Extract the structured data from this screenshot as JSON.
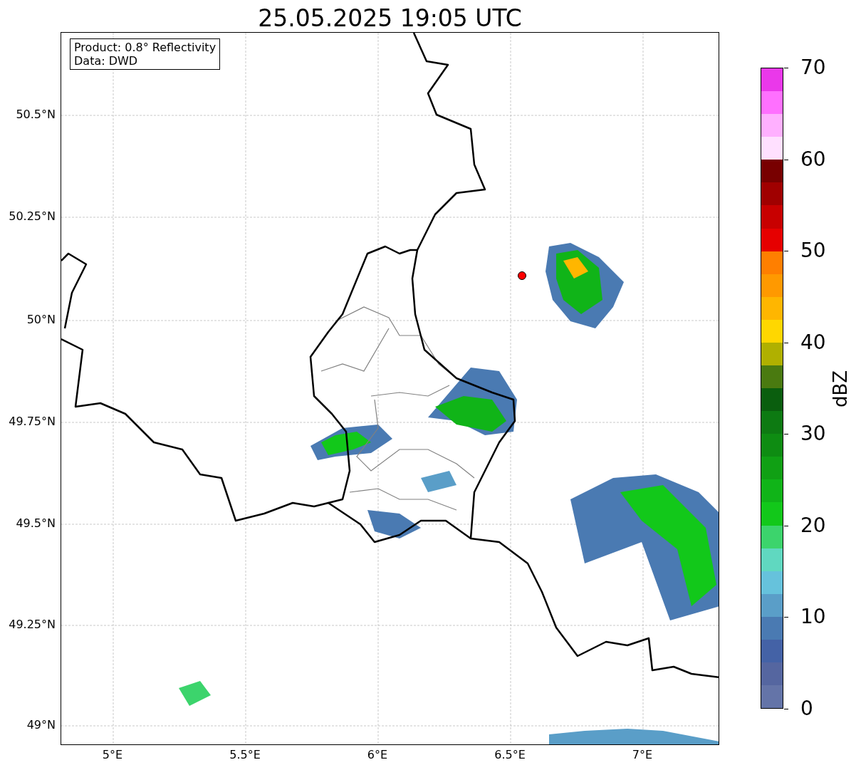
{
  "title": "25.05.2025 19:05 UTC",
  "info_box": [
    "Product: 0.8° Reflectivity",
    "Data: DWD"
  ],
  "lat_ticks": [
    "50.5°N",
    "50.25°N",
    "50°N",
    "49.75°N",
    "49.5°N",
    "49.25°N",
    "49°N"
  ],
  "lon_ticks": [
    "5°E",
    "5.5°E",
    "6°E",
    "6.5°E",
    "7°E"
  ],
  "colorbar": {
    "label": "dBZ",
    "ticks": [
      "70",
      "60",
      "50",
      "40",
      "30",
      "20",
      "10",
      "0"
    ],
    "segments": [
      {
        "color": "#ea38ea"
      },
      {
        "color": "#ff70ff"
      },
      {
        "color": "#ffb0ff"
      },
      {
        "color": "#ffe0ff"
      },
      {
        "color": "#780000"
      },
      {
        "color": "#a00000"
      },
      {
        "color": "#c80000"
      },
      {
        "color": "#e60000"
      },
      {
        "color": "#ff7f00"
      },
      {
        "color": "#ff9900"
      },
      {
        "color": "#ffb600"
      },
      {
        "color": "#ffd700"
      },
      {
        "color": "#b0b000"
      },
      {
        "color": "#4a7a10"
      },
      {
        "color": "#0a5e0e"
      },
      {
        "color": "#0d7a12"
      },
      {
        "color": "#0e8c12"
      },
      {
        "color": "#10a014"
      },
      {
        "color": "#10b418"
      },
      {
        "color": "#12c81a"
      },
      {
        "color": "#3cd46c"
      },
      {
        "color": "#60d8c0"
      },
      {
        "color": "#66c2dc"
      },
      {
        "color": "#5a9ec8"
      },
      {
        "color": "#4a7ab2"
      },
      {
        "color": "#4462a6"
      },
      {
        "color": "#5566a0"
      },
      {
        "color": "#6474a8"
      }
    ]
  }
}
